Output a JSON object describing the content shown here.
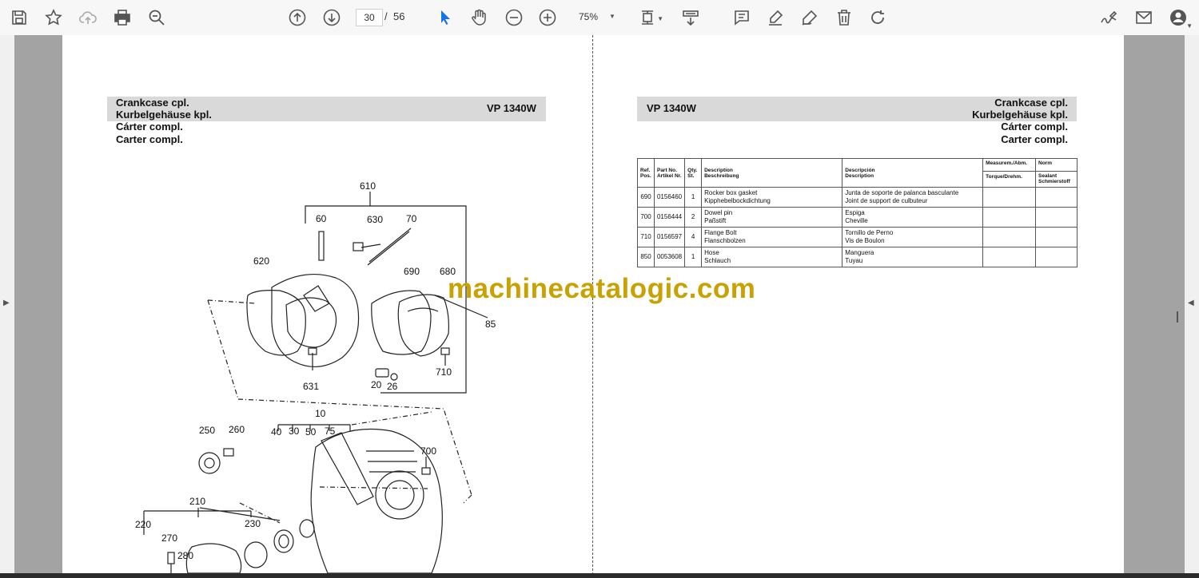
{
  "toolbar": {
    "current_page": "30",
    "page_separator": "/",
    "total_pages": "56",
    "zoom": "75%"
  },
  "left_page": {
    "header_lines": [
      "Crankcase cpl.",
      "Kurbelgehäuse kpl.",
      "Cárter compl.",
      "Carter compl."
    ],
    "model": "VP 1340W",
    "diagram_labels": [
      "610",
      "60",
      "630",
      "70",
      "620",
      "690",
      "680",
      "850",
      "710",
      "631",
      "20",
      "26",
      "10",
      "250",
      "260",
      "40",
      "30",
      "50",
      "75",
      "700",
      "210",
      "220",
      "230",
      "270",
      "280"
    ]
  },
  "right_page": {
    "header_lines": [
      "Crankcase cpl.",
      "Kurbelgehäuse kpl.",
      "Cárter compl.",
      "Carter compl."
    ],
    "model": "VP 1340W",
    "table": {
      "headers": {
        "ref": [
          "Ref.",
          "Pos."
        ],
        "part": [
          "Part No.",
          "Artikel Nr."
        ],
        "qty": [
          "Qty.",
          "St."
        ],
        "desc1": [
          "Description",
          "Beschreibung"
        ],
        "desc2": [
          "Descripción",
          "Description"
        ],
        "measure": [
          "Measurem./Abm.",
          "Torque/Drehm."
        ],
        "norm": [
          "Norm",
          "Sealant",
          "Schmierstoff"
        ]
      },
      "rows": [
        {
          "ref": "690",
          "part": "0156460",
          "qty": "1",
          "desc1_a": "Rocker box gasket",
          "desc1_b": "Kipphebelbockdichtung",
          "desc2_a": "Junta de soporte de palanca basculante",
          "desc2_b": "Joint de support de culbuteur"
        },
        {
          "ref": "700",
          "part": "0156444",
          "qty": "2",
          "desc1_a": "Dowel pin",
          "desc1_b": "Paßstift",
          "desc2_a": "Espiga",
          "desc2_b": "Cheville"
        },
        {
          "ref": "710",
          "part": "0156597",
          "qty": "4",
          "desc1_a": "Flange Bolt",
          "desc1_b": "Flanschbolzen",
          "desc2_a": "Tornillo de Perno",
          "desc2_b": "Vis de Boulon"
        },
        {
          "ref": "850",
          "part": "0053608",
          "qty": "1",
          "desc1_a": "Hose",
          "desc1_b": "Schlauch",
          "desc2_a": "Manguera",
          "desc2_b": "Tuyau"
        }
      ]
    }
  },
  "watermark": "machinecatalogic.com",
  "colors": {
    "toolbar_bg": "#f7f7f7",
    "viewer_bg": "#a3a3a3",
    "header_band": "#d9d9d9",
    "watermark": "#c9a100",
    "icon": "#555555",
    "select_cursor": "#1473e6"
  },
  "icons": {
    "save": "save-icon",
    "bookmark": "star-icon",
    "upload": "cloud-upload-icon",
    "print": "print-icon",
    "zoom_search": "zoom-search-icon",
    "prev": "arrow-up-circle-icon",
    "next": "arrow-down-circle-icon",
    "select": "cursor-arrow-icon",
    "hand": "hand-icon",
    "zoom_out": "minus-circle-icon",
    "zoom_in": "plus-circle-icon",
    "page_fit": "page-fit-icon",
    "scroll_mode": "scroll-mode-icon",
    "comment": "comment-icon",
    "highlight": "highlight-pen-icon",
    "draw": "draw-icon",
    "delete": "trash-icon",
    "rotate": "rotate-icon",
    "sign": "sign-icon",
    "email": "email-icon",
    "account": "account-icon"
  }
}
